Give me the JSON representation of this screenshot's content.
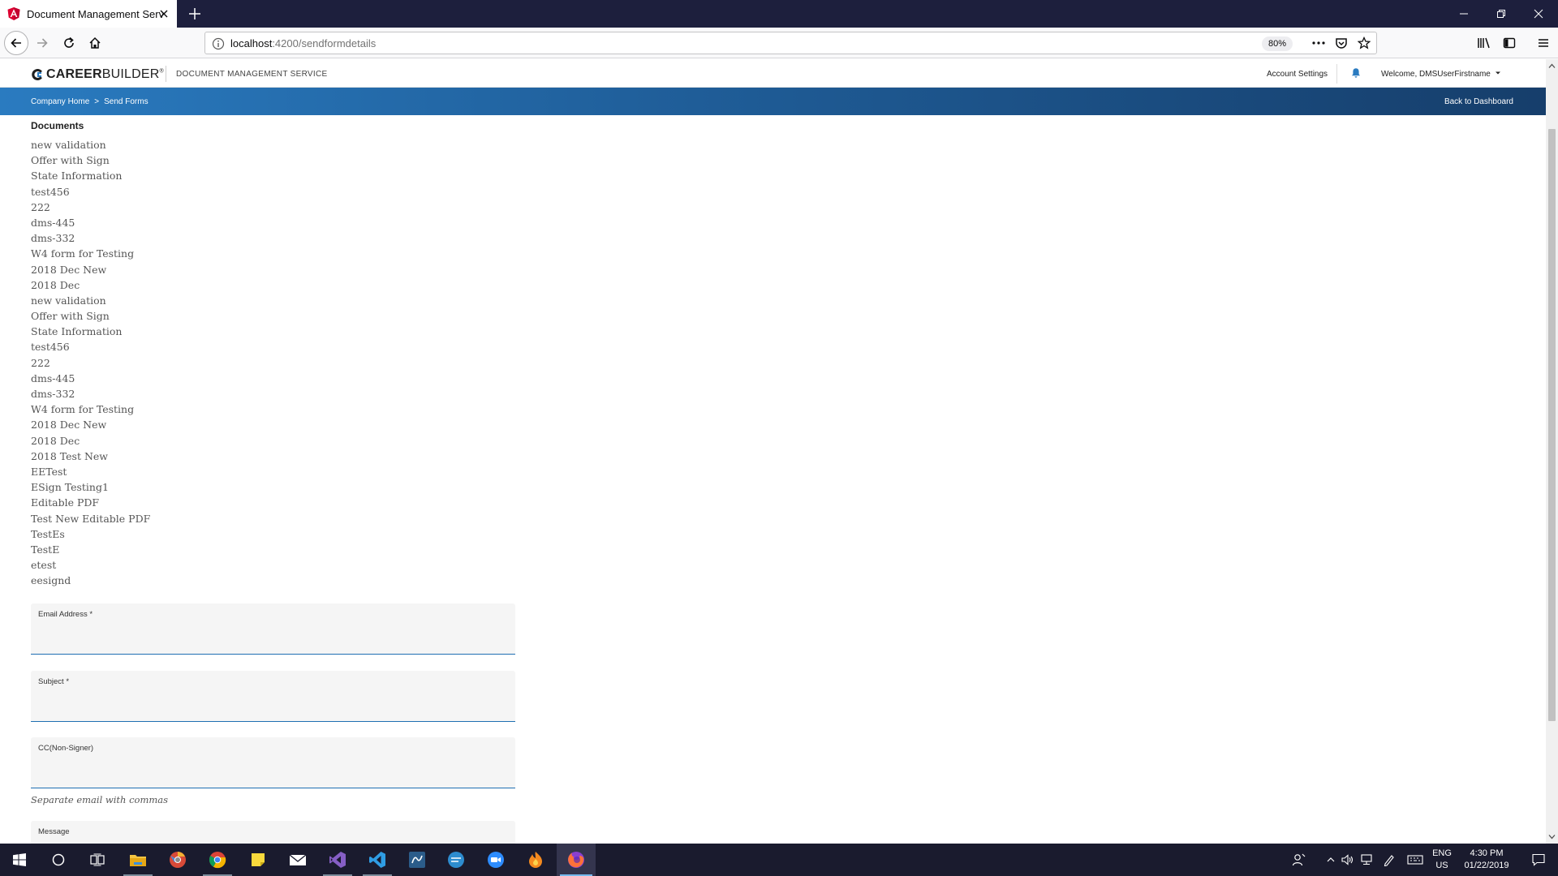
{
  "browser": {
    "tab_title": "Document Management Servic",
    "url_host": "localhost",
    "url_path": ":4200/sendformdetails",
    "zoom": "80%"
  },
  "header": {
    "logo_bold": "CAREER",
    "logo_light": "BUILDER",
    "logo_mark": "®",
    "product": "DOCUMENT MANAGEMENT SERVICE",
    "account_settings": "Account Settings",
    "welcome": "Welcome, DMSUserFirstname"
  },
  "breadcrumb": {
    "home": "Company Home",
    "separator": ">",
    "current": "Send Forms",
    "back": "Back to Dashboard"
  },
  "documents": {
    "title": "Documents",
    "items": [
      "new validation",
      "Offer with Sign",
      "State Information",
      "test456",
      "222",
      "dms-445",
      "dms-332",
      "W4 form for Testing",
      "2018 Dec New",
      "2018 Dec",
      "new validation",
      "Offer with Sign",
      "State Information",
      "test456",
      "222",
      "dms-445",
      "dms-332",
      "W4 form for Testing",
      "2018 Dec New",
      "2018 Dec",
      "2018 Test New",
      "EETest",
      "ESign Testing1",
      "Editable PDF",
      "Test New Editable PDF",
      "TestEs",
      "TestE",
      "etest",
      "eesignd"
    ]
  },
  "form": {
    "email_label": "Email Address *",
    "email_value": "",
    "subject_label": "Subject *",
    "subject_value": "",
    "cc_label": "CC(Non-Signer)",
    "cc_value": "",
    "cc_hint": "Separate email with commas",
    "message_label": "Message"
  },
  "taskbar": {
    "lang_top": "ENG",
    "lang_bottom": "US",
    "time": "4:30 PM",
    "date": "01/22/2019"
  },
  "colors": {
    "accent": "#1f6fb2",
    "header_gradient_start": "#2a7bc0",
    "header_gradient_end": "#163e6b",
    "titlebar": "#1d1f3d",
    "taskbar": "#1a1b2e"
  }
}
